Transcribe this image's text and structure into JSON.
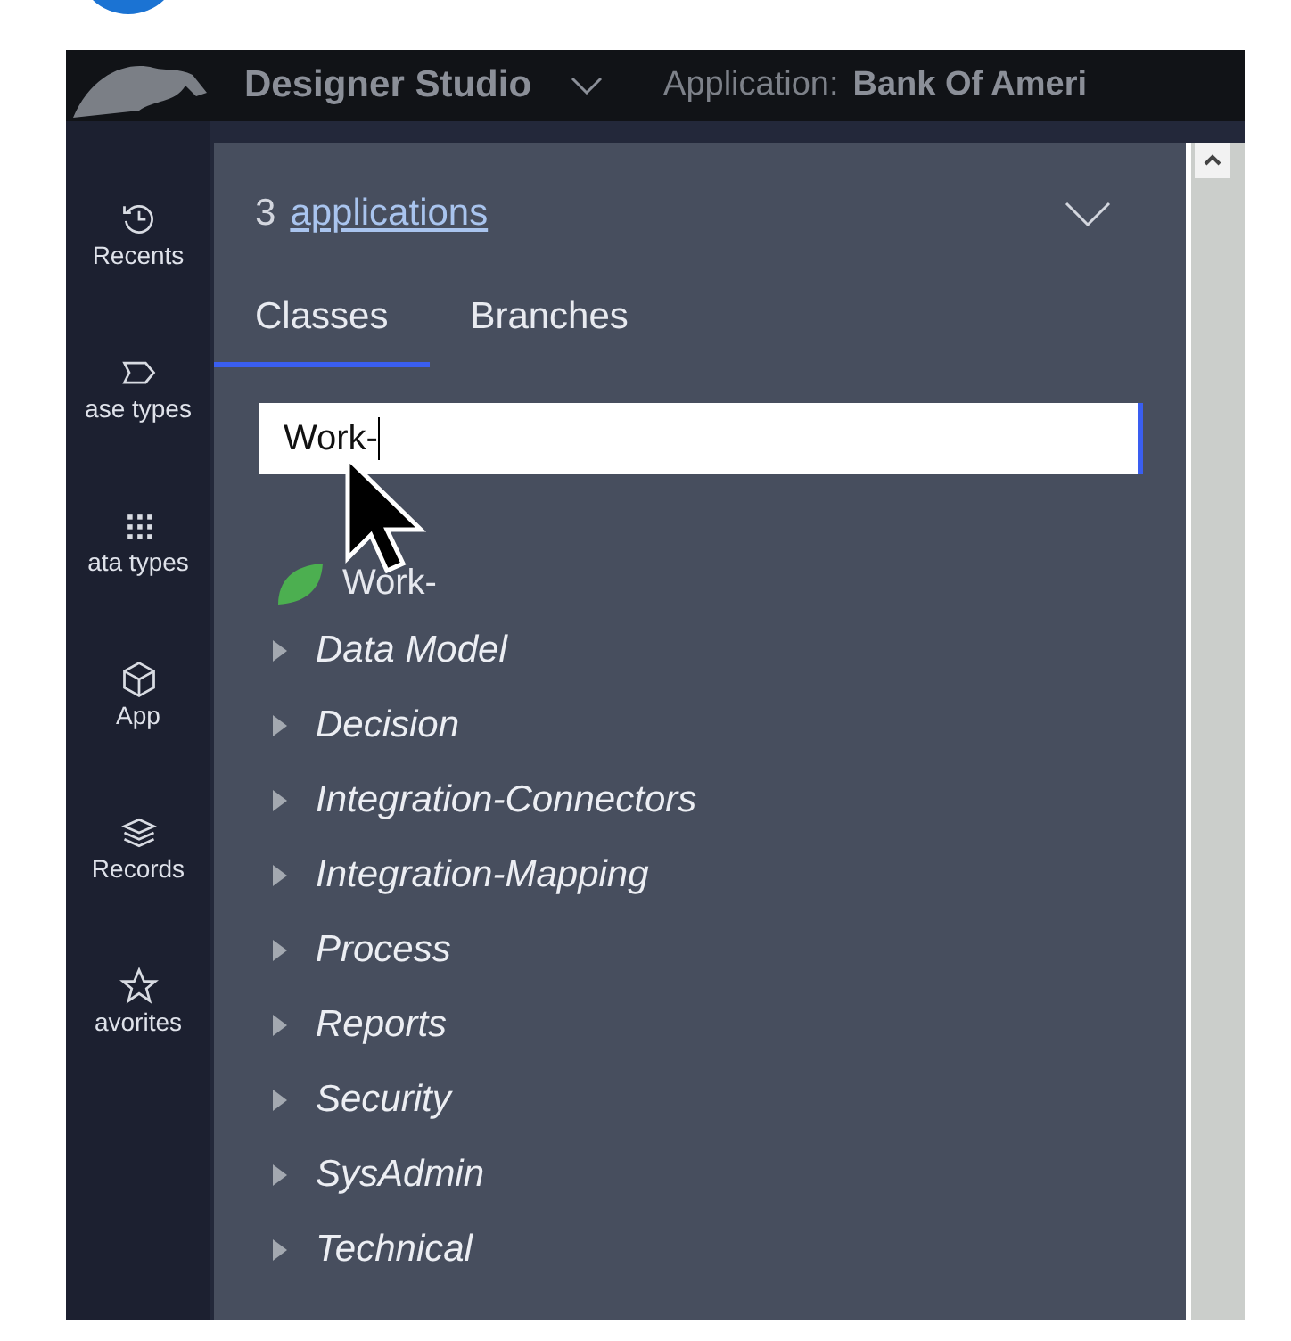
{
  "top_bar": {
    "product": "Designer Studio",
    "application_label": "Application:",
    "application_name": "Bank Of Ameri"
  },
  "nav": [
    {
      "label": "Recents"
    },
    {
      "label": "ase types"
    },
    {
      "label": "ata types"
    },
    {
      "label": "App"
    },
    {
      "label": "Records"
    },
    {
      "label": "avorites"
    }
  ],
  "panel": {
    "count": "3",
    "link": "applications",
    "tabs": [
      {
        "label": "Classes",
        "selected": true
      },
      {
        "label": "Branches",
        "selected": false
      }
    ],
    "search": {
      "value": "Work-"
    },
    "tree": {
      "label": "Work-",
      "children": [
        {
          "label": "Data Model",
          "expanded": false
        },
        {
          "label": "Decision",
          "expanded": false
        },
        {
          "label": "Integration-Connectors",
          "expanded": false
        },
        {
          "label": "Integration-Mapping",
          "expanded": false
        },
        {
          "label": "Process",
          "expanded": false
        },
        {
          "label": "Reports",
          "expanded": false
        },
        {
          "label": "Security",
          "expanded": false
        },
        {
          "label": "SysAdmin",
          "expanded": false
        },
        {
          "label": "Technical",
          "expanded": false
        }
      ]
    }
  }
}
